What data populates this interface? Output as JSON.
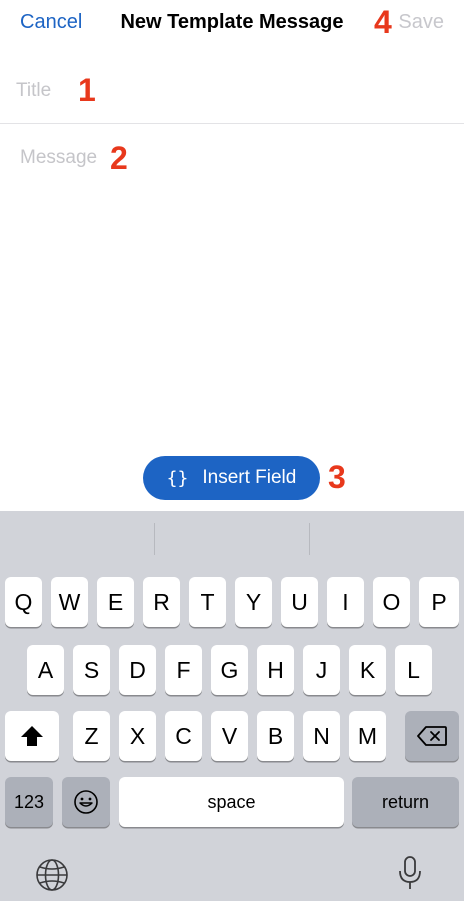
{
  "nav": {
    "cancel_label": "Cancel",
    "title": "New Template Message",
    "save_label": "Save"
  },
  "annotations": [
    "1",
    "2",
    "3",
    "4"
  ],
  "form": {
    "title_placeholder": "Title",
    "message_placeholder": "Message"
  },
  "insert_field": {
    "icon": "{}",
    "label": "Insert Field"
  },
  "keyboard": {
    "row1": [
      "Q",
      "W",
      "E",
      "R",
      "T",
      "Y",
      "U",
      "I",
      "O",
      "P"
    ],
    "row2": [
      "A",
      "S",
      "D",
      "F",
      "G",
      "H",
      "J",
      "K",
      "L"
    ],
    "row3": [
      "Z",
      "X",
      "C",
      "V",
      "B",
      "N",
      "M"
    ],
    "numbers_label": "123",
    "space_label": "space",
    "return_label": "return",
    "icons": {
      "shift": "shift-icon",
      "delete": "delete-icon",
      "emoji": "emoji-icon",
      "globe": "globe-icon",
      "microphone": "microphone-icon"
    }
  },
  "colors": {
    "accent": "#1d64c4",
    "annotation": "#e8381c",
    "keyboard_bg": "#d1d3d9"
  }
}
